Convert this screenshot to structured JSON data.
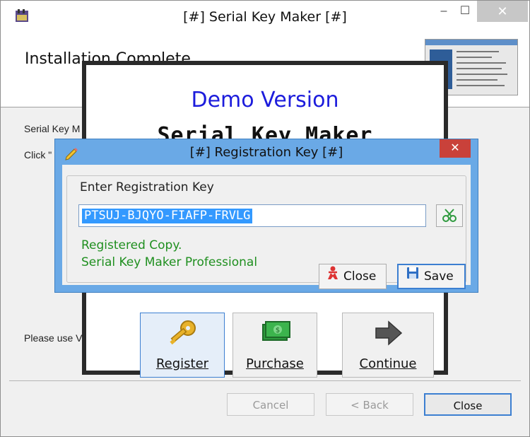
{
  "window": {
    "title": "[#] Serial Key Maker [#]",
    "minimize_glyph": "–",
    "maximize_glyph": "☐",
    "close_glyph": "✕"
  },
  "header": {
    "title": "Installation Complete"
  },
  "body": {
    "line1": "Serial Key M",
    "line2": "Click \"",
    "line3": "Please use V"
  },
  "footer": {
    "cancel": "Cancel",
    "back": "< Back",
    "close": "Close"
  },
  "demo": {
    "title": "Demo Version",
    "product": "Serial Key Maker",
    "buttons": {
      "register": "Register",
      "purchase": "Purchase",
      "continue": "Continue"
    }
  },
  "registration_dialog": {
    "title": "[#] Registration Key [#]",
    "close_glyph": "✕",
    "group_label": "Enter Registration Key",
    "key_value": "PTSUJ-BJQYO-FIAFP-FRVLG",
    "status_line1": "Registered Copy.",
    "status_line2": "Serial Key Maker Professional",
    "close_button": "Close",
    "save_button": "Save"
  },
  "icons": {
    "app": "app-icon",
    "edit": "pencil-icon",
    "paste": "paste-key-icon",
    "register": "key-icon",
    "purchase": "money-icon",
    "continue": "arrow-right-icon",
    "close": "person-close-icon",
    "save": "floppy-disk-icon"
  },
  "colors": {
    "dialog_frame": "#6aa9e6",
    "close_red": "#c9413a",
    "demo_blue": "#1c1cdc",
    "status_green": "#1f8f1f",
    "selection": "#3399ff"
  }
}
